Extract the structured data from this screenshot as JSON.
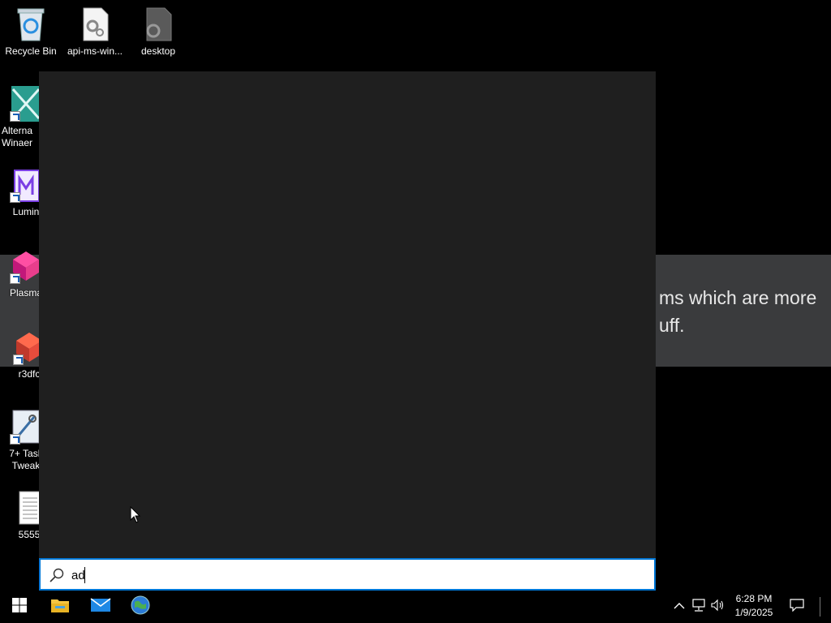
{
  "desktop": {
    "icons": [
      {
        "label": "Recycle Bin"
      },
      {
        "label": "api-ms-win..."
      },
      {
        "label": "desktop"
      },
      {
        "label": "Alterna Winaer"
      },
      {
        "label": "Lumin"
      },
      {
        "label": "Plasma"
      },
      {
        "label": "r3dfc"
      },
      {
        "label": "7+ Task Tweak"
      },
      {
        "label": "5555"
      }
    ]
  },
  "background_window": {
    "line1": "ms which are more",
    "line2": "uff."
  },
  "search": {
    "query": "ad",
    "icon": "search-icon",
    "accent_color": "#0078d7"
  },
  "taskbar": {
    "pinned": [
      {
        "icon": "windows-start-icon"
      },
      {
        "icon": "file-explorer-icon"
      },
      {
        "icon": "mail-icon"
      },
      {
        "icon": "browser-globe-icon"
      }
    ],
    "tray": {
      "icons": [
        "chevron-up-icon",
        "network-icon",
        "volume-icon",
        "notifications-icon"
      ],
      "time": "6:28 PM",
      "date": "1/9/2025"
    }
  }
}
